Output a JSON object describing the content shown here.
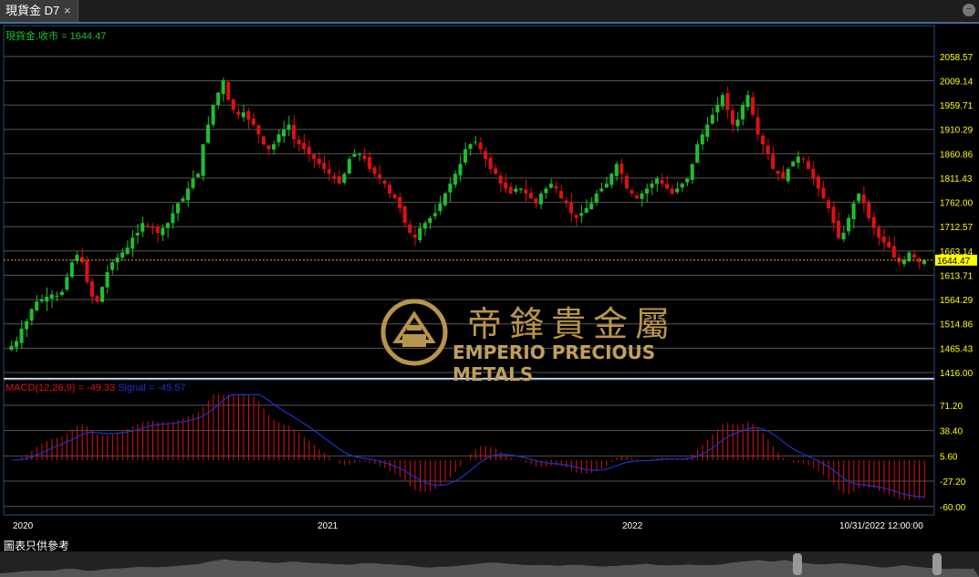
{
  "tab": {
    "title": "現貨金 D7",
    "close": "×"
  },
  "window": {
    "min_glyph": "−"
  },
  "legend_main": "現貨金.收市 = 1644.47",
  "legend_macd": "MACD(12,26,9) = -49.33",
  "legend_signal": "Signal = -45.57",
  "watermark": {
    "cn": "帝鋒貴金屬",
    "en": "EMPERIO PRECIOUS METALS"
  },
  "footer": "圖表只供參考",
  "colors": {
    "up": "#1fbf2e",
    "down": "#e01010",
    "grid": "#555555",
    "axis_text": "#ffff00",
    "signal": "#2030d0",
    "macd": "#e01010",
    "last_price": "#ffa500"
  },
  "chart_data": [
    {
      "type": "candlestick",
      "title": "",
      "yaxis_ticks": [
        2058.57,
        2009.14,
        1959.71,
        1910.29,
        1860.86,
        1811.43,
        1762.0,
        1712.57,
        1663.14,
        1613.71,
        1564.29,
        1514.86,
        1465.43,
        1416.0
      ],
      "ylim": [
        1416.0,
        2088
      ],
      "last_price": 1644.47,
      "last_price_label": "1644.47",
      "x_labels": [
        "2020",
        "2021",
        "2022",
        "10/31/2022 12:00:00"
      ],
      "close_path": [
        1470,
        1480,
        1505,
        1520,
        1545,
        1560,
        1565,
        1570,
        1575,
        1572,
        1580,
        1610,
        1640,
        1655,
        1640,
        1600,
        1570,
        1560,
        1590,
        1620,
        1640,
        1650,
        1660,
        1670,
        1690,
        1700,
        1720,
        1715,
        1710,
        1700,
        1710,
        1720,
        1740,
        1760,
        1770,
        1790,
        1810,
        1820,
        1880,
        1920,
        1960,
        1985,
        2010,
        1970,
        1950,
        1940,
        1945,
        1930,
        1920,
        1900,
        1880,
        1870,
        1880,
        1900,
        1910,
        1920,
        1890,
        1880,
        1870,
        1860,
        1850,
        1840,
        1830,
        1820,
        1810,
        1800,
        1820,
        1850,
        1860,
        1860,
        1850,
        1830,
        1820,
        1810,
        1800,
        1780,
        1770,
        1750,
        1720,
        1700,
        1690,
        1710,
        1720,
        1730,
        1740,
        1760,
        1780,
        1800,
        1820,
        1840,
        1870,
        1880,
        1885,
        1870,
        1850,
        1830,
        1820,
        1800,
        1790,
        1780,
        1790,
        1790,
        1780,
        1770,
        1760,
        1780,
        1790,
        1800,
        1790,
        1770,
        1760,
        1740,
        1730,
        1740,
        1750,
        1760,
        1780,
        1790,
        1800,
        1820,
        1840,
        1820,
        1790,
        1780,
        1770,
        1780,
        1790,
        1800,
        1810,
        1800,
        1790,
        1780,
        1790,
        1800,
        1810,
        1840,
        1880,
        1900,
        1920,
        1940,
        1960,
        1980,
        1950,
        1920,
        1930,
        1960,
        1980,
        1940,
        1900,
        1880,
        1860,
        1830,
        1820,
        1810,
        1830,
        1845,
        1855,
        1850,
        1830,
        1810,
        1790,
        1770,
        1750,
        1720,
        1690,
        1700,
        1730,
        1760,
        1780,
        1760,
        1730,
        1710,
        1690,
        1680,
        1670,
        1650,
        1640,
        1645,
        1660,
        1650,
        1640,
        1644.47
      ]
    },
    {
      "type": "macd",
      "yaxis_ticks": [
        71.2,
        38.4,
        5.6,
        -27.2,
        -60.0
      ],
      "ylim": [
        -65,
        90
      ],
      "macd_last": -49.33,
      "signal_last": -45.57
    }
  ]
}
